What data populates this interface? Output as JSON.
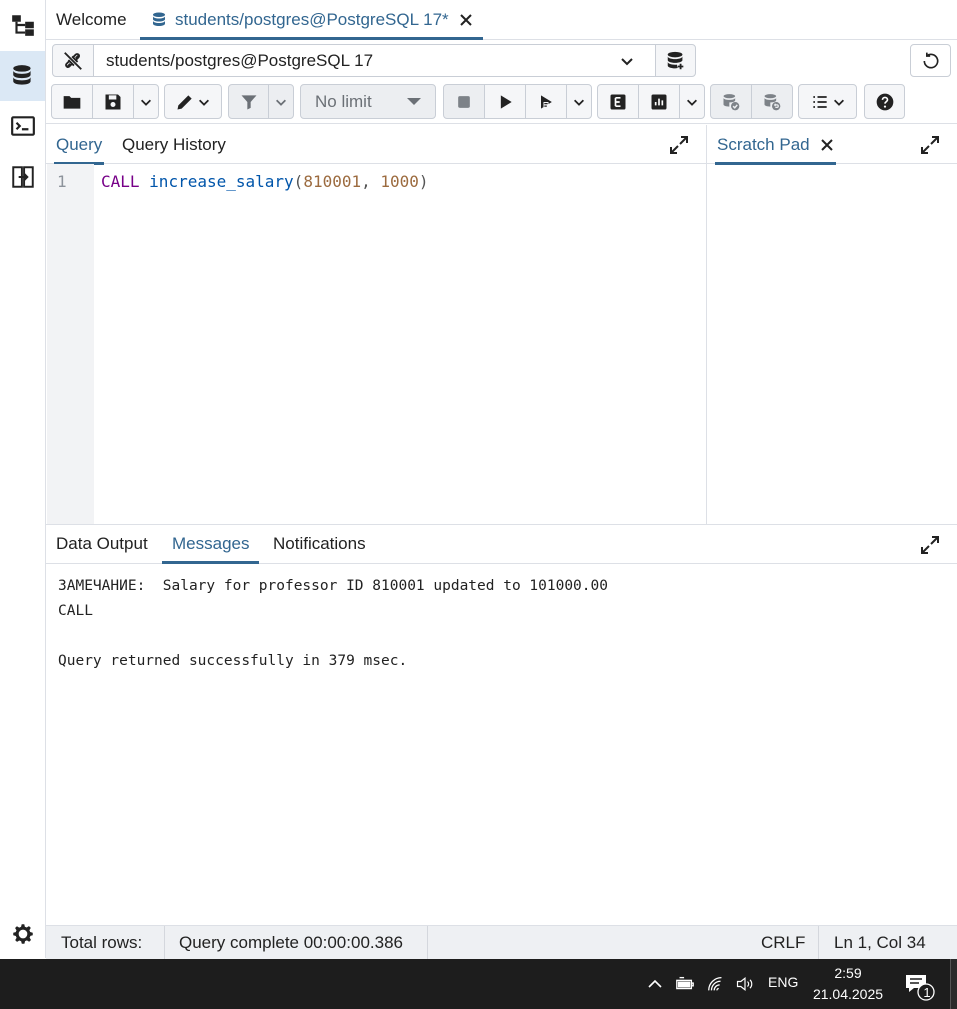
{
  "tabs": {
    "welcome_label": "Welcome",
    "active_label": "students/postgres@PostgreSQL 17*"
  },
  "connection": {
    "selected": "students/postgres@PostgreSQL 17"
  },
  "toolbar": {
    "limit_label": "No limit"
  },
  "query_panel": {
    "tab_query": "Query",
    "tab_history": "Query History",
    "line_number": "1",
    "code": {
      "keyword": "CALL",
      "function": "increase_salary",
      "open": "(",
      "arg1": "810001",
      "sep": ", ",
      "arg2": "1000",
      "close": ")"
    }
  },
  "scratch_pad": {
    "label": "Scratch Pad"
  },
  "results": {
    "tab_data_output": "Data Output",
    "tab_messages": "Messages",
    "tab_notifications": "Notifications",
    "messages": [
      "ЗАМЕЧАНИЕ:  Salary for professor ID 810001 updated to 101000.00",
      "CALL",
      "",
      "Query returned successfully in 379 msec."
    ]
  },
  "status_bar": {
    "total_rows": "Total rows:",
    "query_complete": "Query complete 00:00:00.386",
    "line_ending": "CRLF",
    "cursor": "Ln 1, Col 34"
  },
  "taskbar": {
    "language": "ENG",
    "time": "2:59",
    "date": "21.04.2025",
    "notification_count": "1"
  },
  "colors": {
    "accent": "#326690",
    "keyword": "#770088",
    "function": "#0055aa",
    "number": "#9c6b3f",
    "taskbar": "#1d1d1d"
  }
}
